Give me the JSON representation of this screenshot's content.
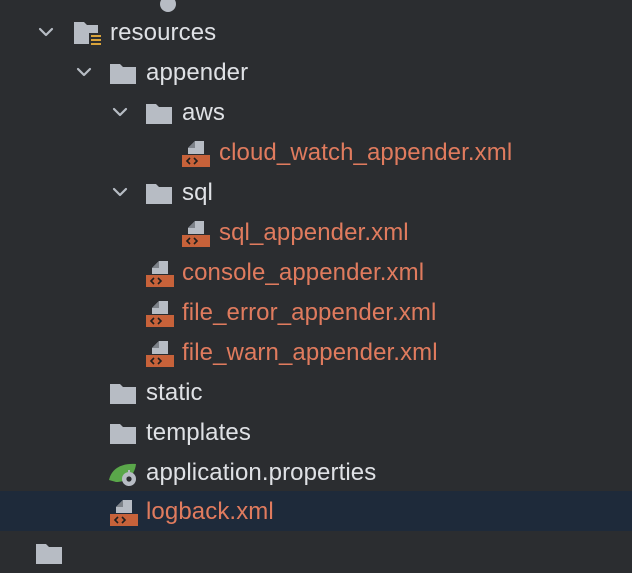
{
  "colors": {
    "background": "#2b2d30",
    "selection": "#1e2a3a",
    "folder_text": "#dfe1e5",
    "xml_text": "#e07b5e",
    "folder_icon": "#b7bcc4",
    "xml_icon": "#c7623a"
  },
  "tree": {
    "resources": {
      "label": "resources",
      "icon": "resources-folder-icon",
      "expanded": true
    },
    "appender": {
      "label": "appender",
      "icon": "folder-icon",
      "expanded": true
    },
    "aws": {
      "label": "aws",
      "icon": "folder-icon",
      "expanded": true
    },
    "cloud_watch": {
      "label": "cloud_watch_appender.xml",
      "icon": "xml-file-icon"
    },
    "sql": {
      "label": "sql",
      "icon": "folder-icon",
      "expanded": true
    },
    "sql_appender": {
      "label": "sql_appender.xml",
      "icon": "xml-file-icon"
    },
    "console_appender": {
      "label": "console_appender.xml",
      "icon": "xml-file-icon"
    },
    "file_error_appender": {
      "label": "file_error_appender.xml",
      "icon": "xml-file-icon"
    },
    "file_warn_appender": {
      "label": "file_warn_appender.xml",
      "icon": "xml-file-icon"
    },
    "static": {
      "label": "static",
      "icon": "folder-icon"
    },
    "templates": {
      "label": "templates",
      "icon": "folder-icon"
    },
    "application_properties": {
      "label": "application.properties",
      "icon": "spring-properties-icon"
    },
    "logback": {
      "label": "logback.xml",
      "icon": "xml-file-icon",
      "selected": true
    }
  }
}
